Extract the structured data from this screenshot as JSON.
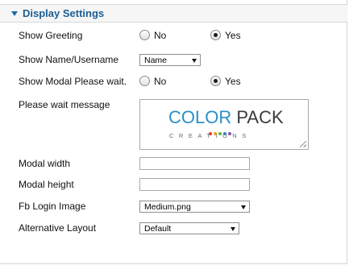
{
  "section": {
    "title": "Display Settings"
  },
  "fields": {
    "show_greeting": {
      "label": "Show Greeting",
      "options": [
        "No",
        "Yes"
      ],
      "selected": "Yes"
    },
    "show_name": {
      "label": "Show Name/Username",
      "value": "Name"
    },
    "show_modal": {
      "label": "Show Modal Please wait.",
      "options": [
        "No",
        "Yes"
      ],
      "selected": "Yes"
    },
    "wait_message": {
      "label": "Please wait message"
    },
    "modal_width": {
      "label": "Modal width",
      "value": ""
    },
    "modal_height": {
      "label": "Modal height",
      "value": ""
    },
    "fb_login_image": {
      "label": "Fb Login Image",
      "value": "Medium.png"
    },
    "alt_layout": {
      "label": "Alternative Layout",
      "value": "Default"
    }
  },
  "logo": {
    "word1": "COLOR",
    "word2": "PACK",
    "sub": "CREATIONS",
    "dot_colors": [
      "#e23b3b",
      "#f2a20f",
      "#5bb64a",
      "#2a8fc9",
      "#8e4fb5"
    ]
  },
  "colors": {
    "accent": "#1a5e93",
    "header_bg": "#f6f6f6"
  }
}
